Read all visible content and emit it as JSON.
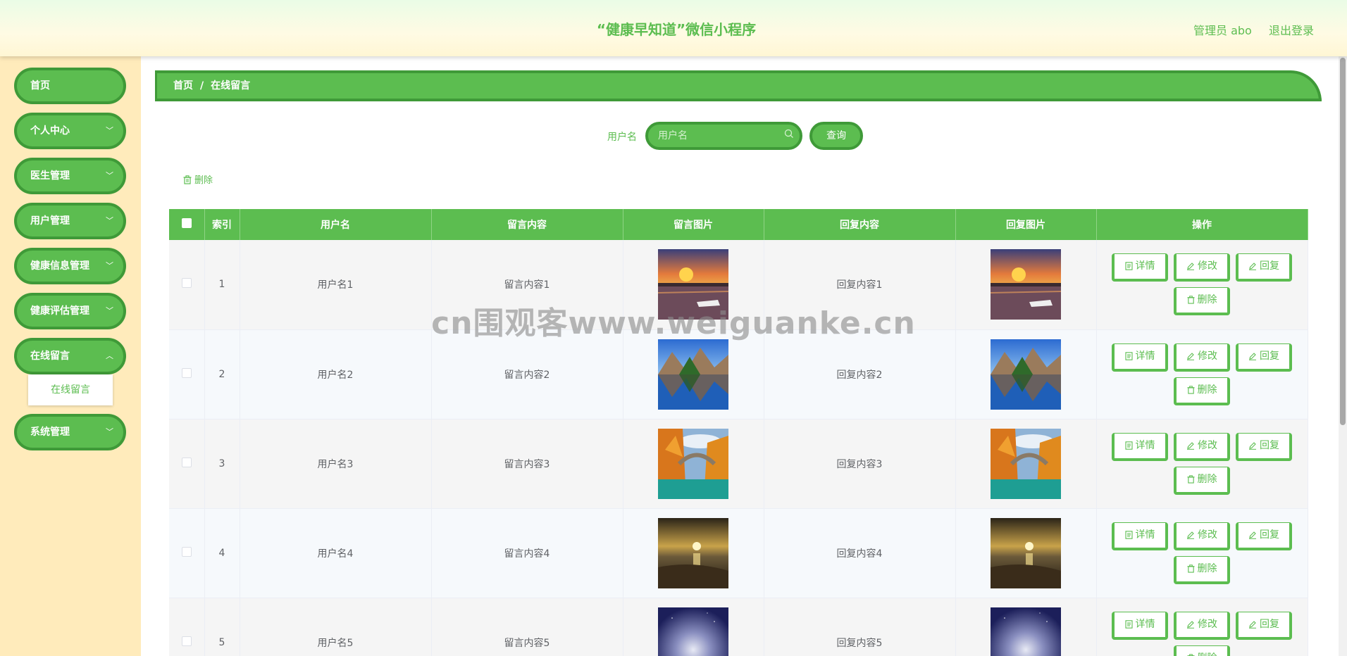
{
  "header": {
    "title": "“健康早知道”微信小程序",
    "user": "管理员 abo",
    "logout": "退出登录"
  },
  "sidebar": {
    "items": [
      {
        "label": "首页",
        "has_chevron": false
      },
      {
        "label": "个人中心",
        "has_chevron": true
      },
      {
        "label": "医生管理",
        "has_chevron": true
      },
      {
        "label": "用户管理",
        "has_chevron": true
      },
      {
        "label": "健康信息管理",
        "has_chevron": true
      },
      {
        "label": "健康评估管理",
        "has_chevron": true
      },
      {
        "label": "在线留言",
        "has_chevron": true,
        "expanded": true
      },
      {
        "label": "系统管理",
        "has_chevron": true
      }
    ],
    "submenu": {
      "label": "在线留言"
    }
  },
  "breadcrumb": {
    "home": "首页",
    "separator": "/",
    "current": "在线留言"
  },
  "search": {
    "label": "用户名",
    "placeholder": "用户名",
    "button": "查询"
  },
  "toolbar": {
    "delete_label": "删除"
  },
  "table": {
    "headers": [
      "索引",
      "用户名",
      "留言内容",
      "留言图片",
      "回复内容",
      "回复图片",
      "操作"
    ],
    "rows": [
      {
        "index": "1",
        "username": "用户名1",
        "content": "留言内容1",
        "reply": "回复内容1",
        "image": "sunset-harbor"
      },
      {
        "index": "2",
        "username": "用户名2",
        "content": "留言内容2",
        "reply": "回复内容2",
        "image": "mountain-lake"
      },
      {
        "index": "3",
        "username": "用户名3",
        "content": "留言内容3",
        "reply": "回复内容3",
        "image": "autumn-bridge"
      },
      {
        "index": "4",
        "username": "用户名4",
        "content": "留言内容4",
        "reply": "回复内容4",
        "image": "beach-sunset"
      },
      {
        "index": "5",
        "username": "用户名5",
        "content": "留言内容5",
        "reply": "回复内容5",
        "image": "night-sky"
      }
    ],
    "actions": {
      "detail": "详情",
      "edit": "修改",
      "reply": "回复",
      "delete": "删除"
    }
  },
  "watermark": "cn围观客www.weiguanke.cn",
  "colors": {
    "accent": "#5cbd50",
    "accent_dark": "#3f9a38",
    "sidebar_bg": "#ffebbb"
  }
}
